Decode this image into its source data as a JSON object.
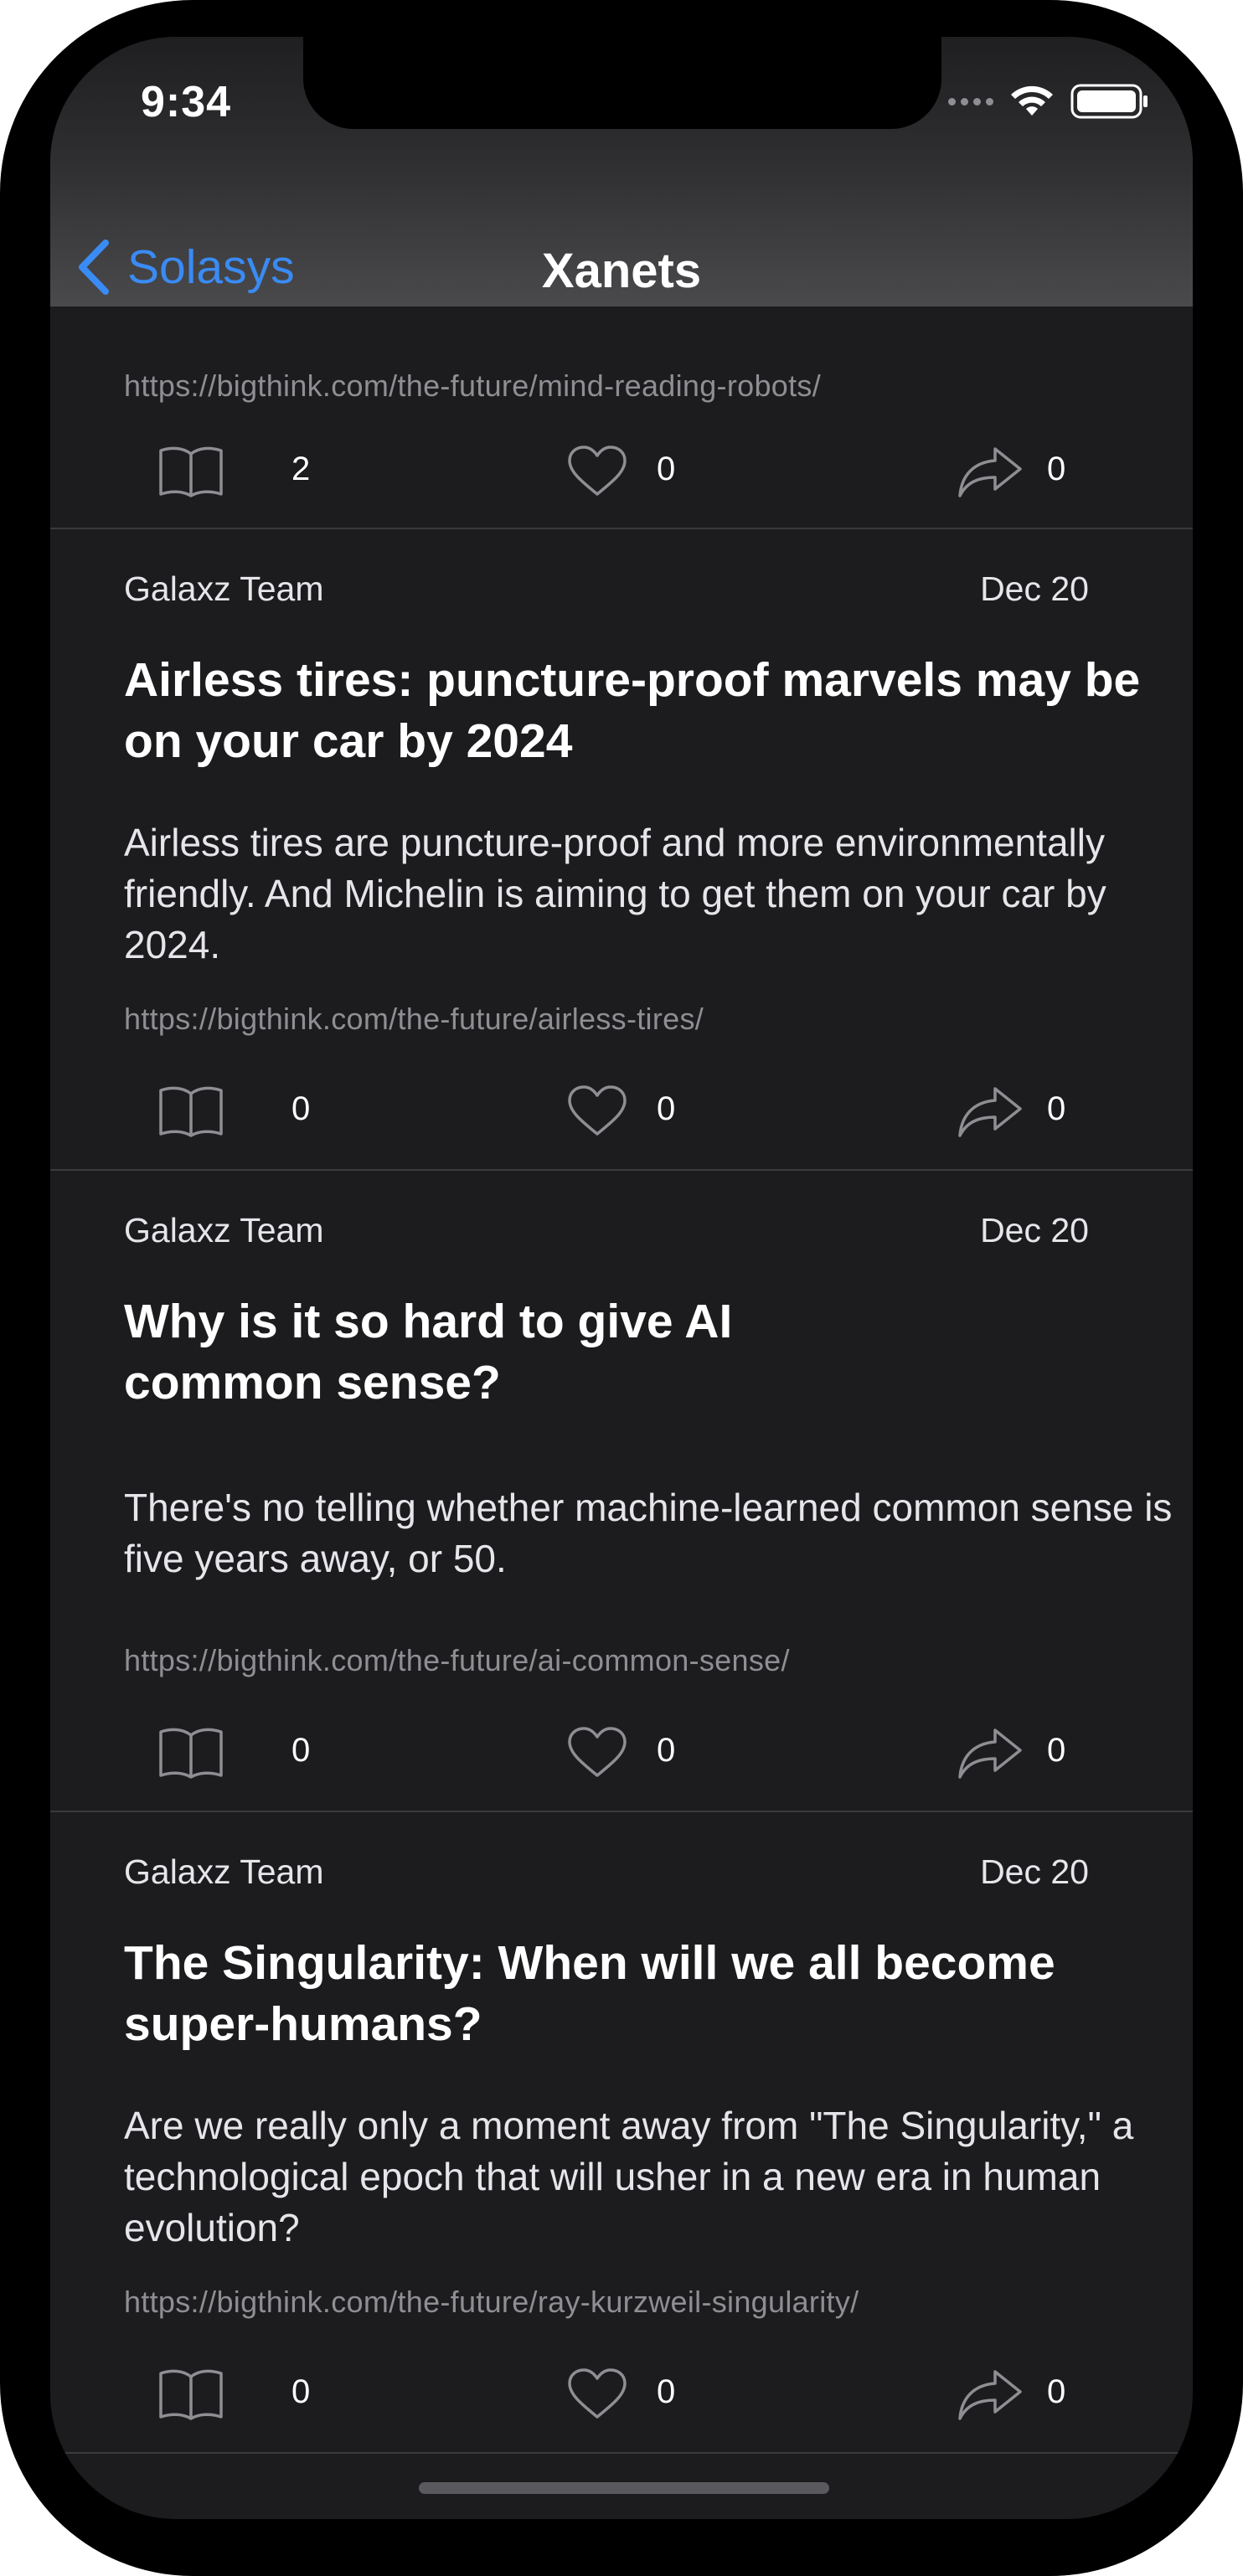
{
  "status_bar": {
    "time": "9:34"
  },
  "nav": {
    "back_label": "Solasys",
    "title": "Xanets"
  },
  "colors": {
    "accent": "#3a8bf4",
    "background": "#1c1c1e",
    "text_primary": "#ffffff",
    "text_secondary": "#8e8e93"
  },
  "partial_card": {
    "url": "https://bigthink.com/the-future/mind-reading-robots/",
    "reads": "2",
    "likes": "0",
    "shares": "0"
  },
  "cards": [
    {
      "author": "Galaxz Team",
      "date": "Dec 20",
      "title": "Airless tires: puncture-proof marvels may be on your car by 2024",
      "summary": "Airless tires are puncture-proof and more environmentally friendly. And Michelin is aiming to get them on your car by 2024.",
      "url": "https://bigthink.com/the-future/airless-tires/",
      "reads": "0",
      "likes": "0",
      "shares": "0"
    },
    {
      "author": "Galaxz Team",
      "date": "Dec 20",
      "title": "Why is it so hard to give AI common sense?",
      "summary": "There's no telling whether machine-learned common sense is five years away, or 50.",
      "url": "https://bigthink.com/the-future/ai-common-sense/",
      "reads": "0",
      "likes": "0",
      "shares": "0"
    },
    {
      "author": "Galaxz Team",
      "date": "Dec 20",
      "title": "The Singularity: When will we all become super-humans?",
      "summary": "Are we really only a moment away from \"The Singularity,\" a technological epoch that will usher in a new era in human evolution?",
      "url": "https://bigthink.com/the-future/ray-kurzweil-singularity/",
      "reads": "0",
      "likes": "0",
      "shares": "0"
    }
  ]
}
